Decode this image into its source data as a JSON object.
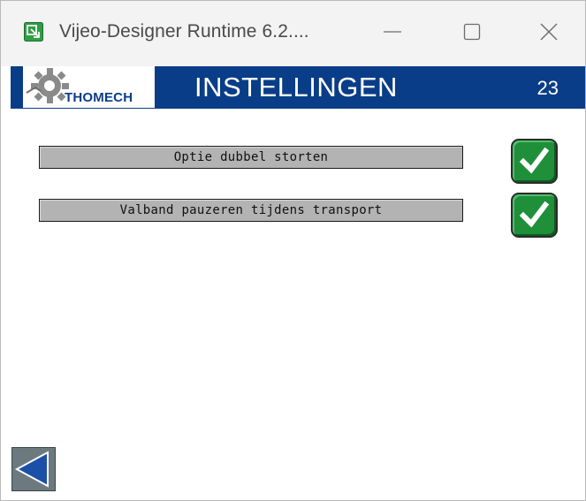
{
  "window": {
    "title": "Vijeo-Designer Runtime 6.2....",
    "icons": {
      "app": "vijeo-app-icon",
      "minimize": "minimize-icon",
      "maximize": "maximize-icon",
      "close": "close-icon"
    }
  },
  "header": {
    "logo_text": "THOMECH",
    "logo_icon": "gear-icon",
    "title": "INSTELLINGEN",
    "page_number": "23"
  },
  "options": [
    {
      "label": "Optie dubbel storten",
      "checked": true
    },
    {
      "label": "Valband pauzeren tijdens transport",
      "checked": true
    }
  ],
  "navigation": {
    "back_icon": "back-arrow-icon"
  },
  "colors": {
    "header_blue": "#0a3d87",
    "check_green": "#1f8f3a",
    "label_gray": "#b3b3b3",
    "back_button": "#6c7a80"
  }
}
